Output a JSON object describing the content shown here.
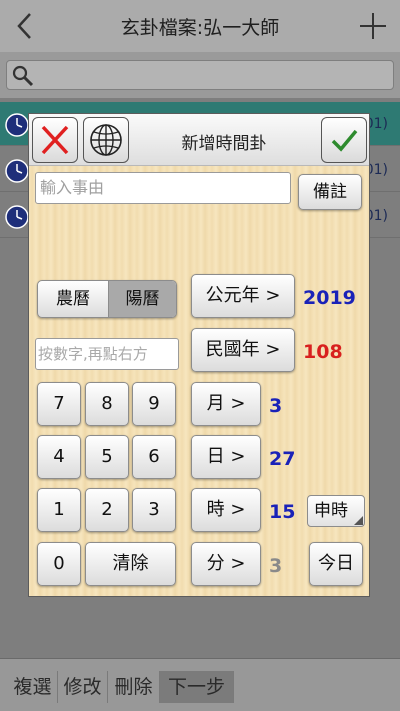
{
  "app": {
    "title": "玄卦檔案:弘一大師",
    "rows": [
      {
        "tail": "01)"
      },
      {
        "tail": "01)"
      },
      {
        "tail": "01)"
      }
    ],
    "bottom": {
      "multi": "複選",
      "edit": "修改",
      "delete": "刪除",
      "next": "下一步"
    }
  },
  "dialog": {
    "title": "新增時間卦",
    "reason_placeholder": "輸入事由",
    "note_label": "備註",
    "calendar_lunar": "農曆",
    "calendar_solar": "陽曆",
    "calendar_selected": "陽曆",
    "numpad_placeholder": "按數字,再點右方",
    "keys": [
      "7",
      "8",
      "9",
      "4",
      "5",
      "6",
      "1",
      "2",
      "3",
      "0"
    ],
    "clear_label": "清除",
    "ad_year_label": "公元年 >",
    "ad_year_value": "2019",
    "roc_year_label": "民國年 >",
    "roc_year_value": "108",
    "month_label": "月 >",
    "month_value": "3",
    "day_label": "日 >",
    "day_value": "27",
    "hour_label": "時 >",
    "hour_value": "15",
    "shichen_value": "申時",
    "minute_label": "分 >",
    "minute_value": "3",
    "today_label": "今日"
  },
  "colors": {
    "ad_year_value": "#1a22b8",
    "roc_year_value": "#d8201e",
    "date_value": "#1a22b8",
    "minute_value": "#8a8a8a",
    "cancel_x": "#e02020",
    "confirm_check": "#2e8b2e"
  },
  "icons": {
    "back": "chevron-left-icon",
    "add": "plus-icon",
    "search": "search-icon",
    "clock": "clock-icon",
    "cancel": "close-icon",
    "globe": "globe-icon",
    "confirm": "check-icon"
  }
}
